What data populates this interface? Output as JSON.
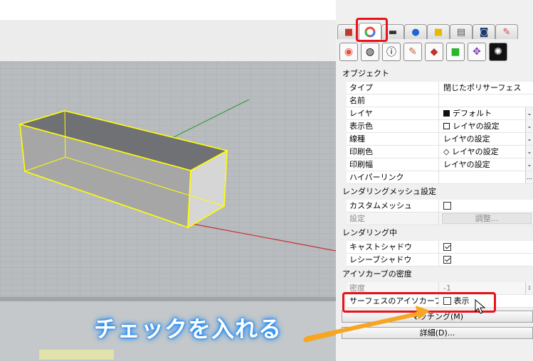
{
  "colors": {
    "accent_red": "#e8121a",
    "callout_glow": "#1a8fff",
    "arrow": "#f5a623",
    "box_edges": "#ffff00"
  },
  "panel": {
    "tabs": [
      "color-wheel-icon",
      "display-icon",
      "ellipse-icon",
      "folder-icon",
      "layer-icon",
      "render-icon",
      "material-icon",
      "book-icon"
    ],
    "icon_row": [
      "color-wheel-icon",
      "mesh-icon",
      "info-icon",
      "rebuild-icon",
      "texture-icon",
      "decal-icon",
      "mapping-icon",
      "swirl-icon"
    ],
    "sections": {
      "object": "オブジェクト",
      "render_mesh": "レンダリングメッシュ設定",
      "rendering": "レンダリング中",
      "isocurve_density": "アイソカーブの密度"
    },
    "rows": {
      "type": {
        "label": "タイプ",
        "value": "閉じたポリサーフェス"
      },
      "name": {
        "label": "名前",
        "value": ""
      },
      "layer": {
        "label": "レイヤ",
        "value": "デフォルト"
      },
      "display_color": {
        "label": "表示色",
        "value": "レイヤの設定"
      },
      "linetype": {
        "label": "線種",
        "value": "レイヤの設定"
      },
      "print_color": {
        "label": "印刷色",
        "value": "◇ レイヤの設定"
      },
      "print_width": {
        "label": "印刷幅",
        "value": "レイヤの設定"
      },
      "hyperlink": {
        "label": "ハイパーリンク",
        "value": ""
      },
      "custom_mesh": {
        "label": "カスタムメッシュ"
      },
      "settings": {
        "label": "設定",
        "button": "調整..."
      },
      "cast_shadow": {
        "label": "キャストシャドウ"
      },
      "receive_shadow": {
        "label": "レシーブシャドウ"
      },
      "density": {
        "label": "密度",
        "value": "-1"
      },
      "show_isocurves": {
        "label": "サーフェスのアイソカーブを表...",
        "value": "表示"
      }
    },
    "checks": {
      "custom_mesh": false,
      "cast_shadow": true,
      "receive_shadow": true,
      "show_isocurves": false
    },
    "buttons": {
      "match": "マッチング(M)",
      "details": "詳細(D)..."
    }
  },
  "callout": {
    "text": "チェックを入れる"
  }
}
